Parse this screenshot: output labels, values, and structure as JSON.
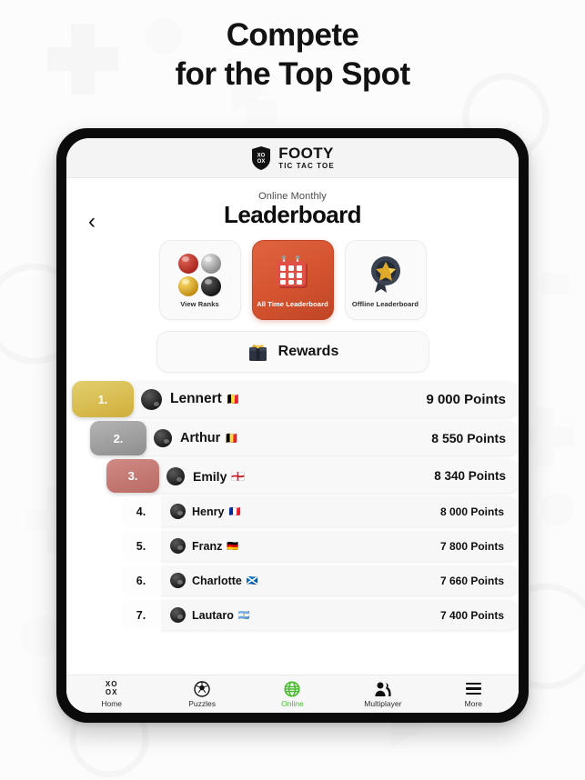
{
  "headline": {
    "line1": "Compete",
    "line2": "for the Top Spot"
  },
  "app": {
    "logo_name": "FOOTY",
    "logo_tagline": "TIC TAC TOE",
    "logo_icon": "shield-xo-icon"
  },
  "header": {
    "back_icon": "back-chevron-icon",
    "subtitle": "Online Monthly",
    "title": "Leaderboard"
  },
  "cards": [
    {
      "label": "View Ranks",
      "icon": "medals-icon",
      "active": false
    },
    {
      "label": "All Time Leaderboard",
      "icon": "calendar-icon",
      "active": true
    },
    {
      "label": "Offline Leaderboard",
      "icon": "star-badge-icon",
      "active": false
    }
  ],
  "rewards": {
    "label": "Rewards",
    "icon": "gift-box-icon"
  },
  "leaderboard": {
    "points_suffix": "Points",
    "rows": [
      {
        "rank": "1.",
        "name": "Lennert",
        "flag": "🇧🇪",
        "points": "9 000 Points",
        "tier": "gold"
      },
      {
        "rank": "2.",
        "name": "Arthur",
        "flag": "🇧🇪",
        "points": "8 550 Points",
        "tier": "silver"
      },
      {
        "rank": "3.",
        "name": "Emily",
        "flag": "🏴󠁧󠁢󠁥󠁮󠁧󠁿",
        "points": "8 340 Points",
        "tier": "bronze"
      },
      {
        "rank": "4.",
        "name": "Henry",
        "flag": "🇫🇷",
        "points": "8 000 Points",
        "tier": "plain"
      },
      {
        "rank": "5.",
        "name": "Franz",
        "flag": "🇩🇪",
        "points": "7 800 Points",
        "tier": "plain"
      },
      {
        "rank": "6.",
        "name": "Charlotte",
        "flag": "🏴󠁧󠁢󠁳󠁣󠁴󠁿",
        "points": "7 660 Points",
        "tier": "plain"
      },
      {
        "rank": "7.",
        "name": "Lautaro",
        "flag": "🇦🇷",
        "points": "7 400 Points",
        "tier": "plain"
      }
    ]
  },
  "bottom_nav": {
    "items": [
      {
        "label": "Home",
        "icon": "xo-grid-icon",
        "active": false
      },
      {
        "label": "Puzzles",
        "icon": "soccer-ball-icon",
        "active": false
      },
      {
        "label": "Online",
        "icon": "globe-icon",
        "active": true
      },
      {
        "label": "Multiplayer",
        "icon": "people-icon",
        "active": false
      },
      {
        "label": "More",
        "icon": "hamburger-icon",
        "active": false
      }
    ]
  },
  "colors": {
    "accent_green": "#49bd2f",
    "active_card": "#d4532f",
    "gold": "#cfae3a",
    "silver": "#8e8e8e",
    "bronze": "#bb6a64",
    "page_bg": "#fcfcfc"
  }
}
